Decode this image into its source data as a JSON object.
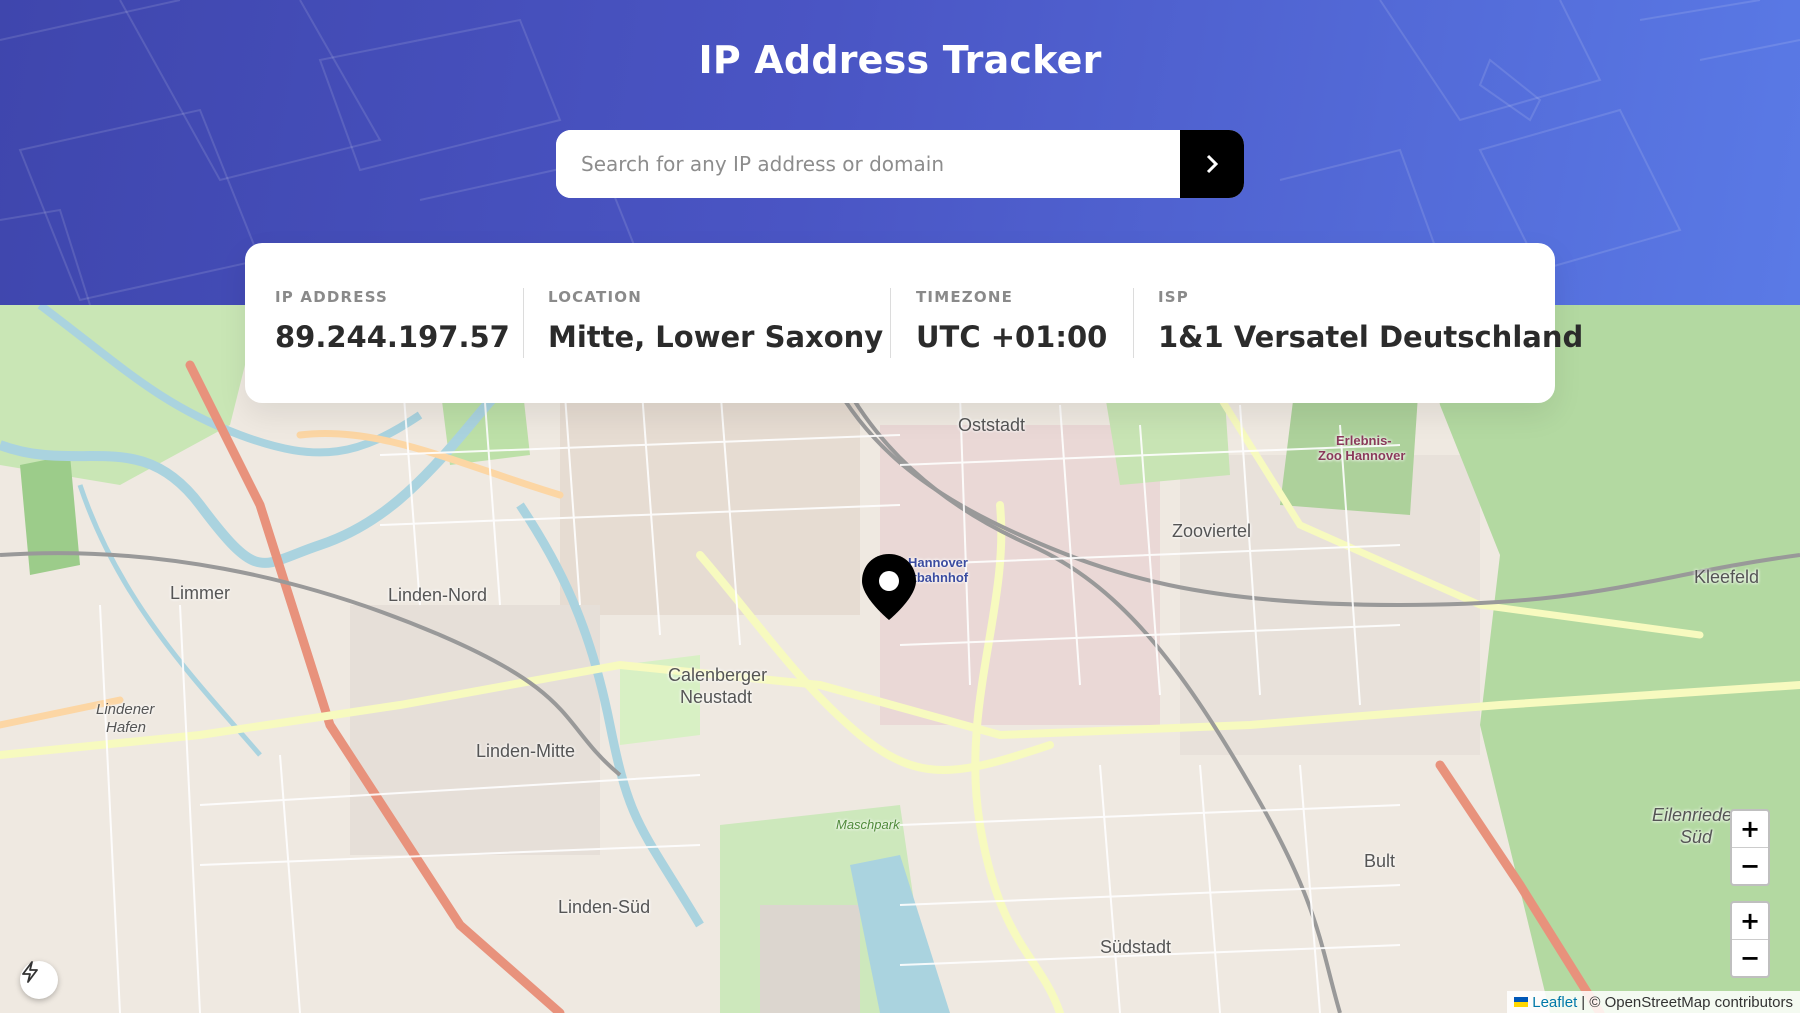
{
  "app": {
    "title": "IP Address Tracker"
  },
  "search": {
    "placeholder": "Search for any IP address or domain",
    "value": ""
  },
  "info": {
    "ip_label": "IP ADDRESS",
    "ip_value": "89.244.197.57",
    "location_label": "LOCATION",
    "location_value": "Mitte, Lower Saxony",
    "timezone_label": "TIMEZONE",
    "timezone_value": "UTC +01:00",
    "isp_label": "ISP",
    "isp_value": "1&1 Versatel Deutschland"
  },
  "map": {
    "labels": {
      "oststadt": "Oststadt",
      "zooviertel": "Zooviertel",
      "kleefeld": "Kleefeld",
      "linden_nord": "Linden-Nord",
      "limmer": "Limmer",
      "calenberger": "Calenberger",
      "neustadt": "Neustadt",
      "linden_mitte": "Linden-Mitte",
      "linden_sued": "Linden-Süd",
      "suedstadt": "Südstadt",
      "bult": "Bult",
      "eilenriede": "Eilenriede-",
      "eilenriede2": "Süd",
      "zoo": "Erlebnis-",
      "zoo2": "Zoo Hannover",
      "hbf": "Hannover",
      "hbf2": "Hauptbahnhof",
      "maschpark": "Maschpark",
      "lindener_hafen": "Lindener",
      "lindener_hafen2": "Hafen"
    },
    "zoom_in": "+",
    "zoom_out": "−",
    "attribution_leaflet": "Leaflet",
    "attribution_rest": "| © OpenStreetMap contributors"
  },
  "colors": {
    "accent": "#000000",
    "header_start": "#3f46ad",
    "header_end": "#5a7ae6"
  }
}
